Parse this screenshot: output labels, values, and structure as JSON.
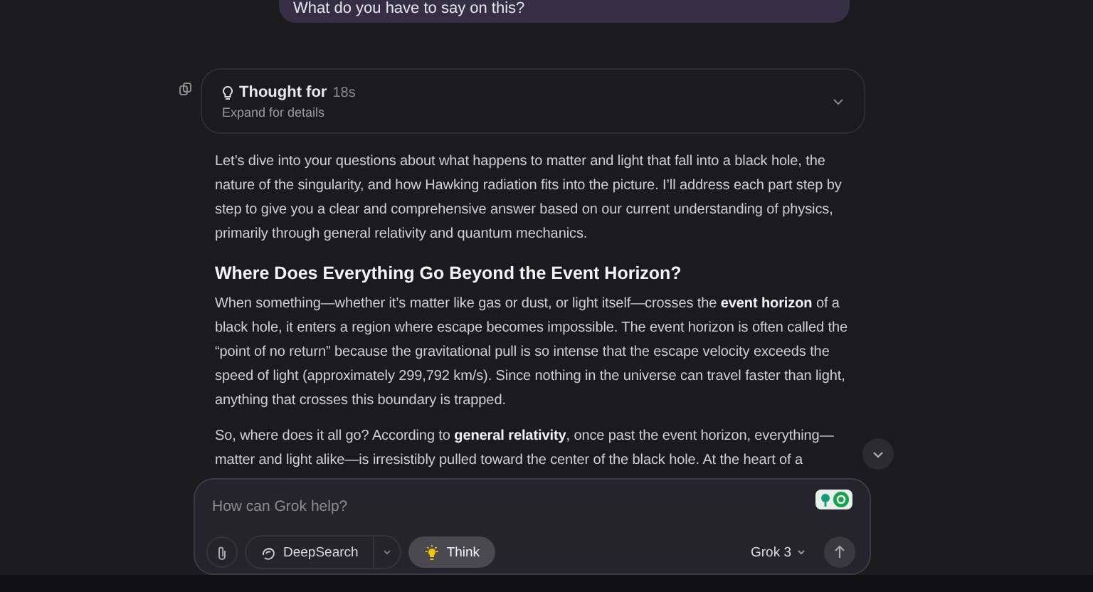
{
  "user_message": {
    "text": "What do you have to say on this?"
  },
  "thought": {
    "label": "Thought for",
    "duration": "18s",
    "hint": "Expand for details",
    "expanded": false
  },
  "response": [
    {
      "kind": "paragraph",
      "text": "Let’s dive into your questions about what happens to matter and light that fall into a black hole, the nature of the singularity, and how Hawking radiation fits into the picture. I’ll address each part step by step to give you a clear and comprehensive answer based on our current understanding of physics, primarily through general relativity and quantum mechanics."
    },
    {
      "kind": "heading",
      "text": "Where Does Everything Go Beyond the Event Horizon?"
    },
    {
      "kind": "paragraph",
      "text": "When something—whether it’s matter like gas or dust, or light itself—crosses the **event horizon** of a black hole, it enters a region where escape becomes impossible. The event horizon is often called the “point of no return” because the gravitational pull is so intense that the escape velocity exceeds the speed of light (approximately 299,792 km/s). Since nothing in the universe can travel faster than light, anything that crosses this boundary is trapped."
    },
    {
      "kind": "paragraph",
      "text": "So, where does it all go? According to **general relativity**, once past the event horizon, everything—matter and light alike—is irresistibly pulled toward the center of the black hole. At the heart of a"
    }
  ],
  "composer": {
    "placeholder": "How can Grok help?",
    "deepsearch": {
      "label": "DeepSearch",
      "selected": false
    },
    "think": {
      "label": "Think",
      "selected": true
    },
    "model": "Grok 3"
  }
}
